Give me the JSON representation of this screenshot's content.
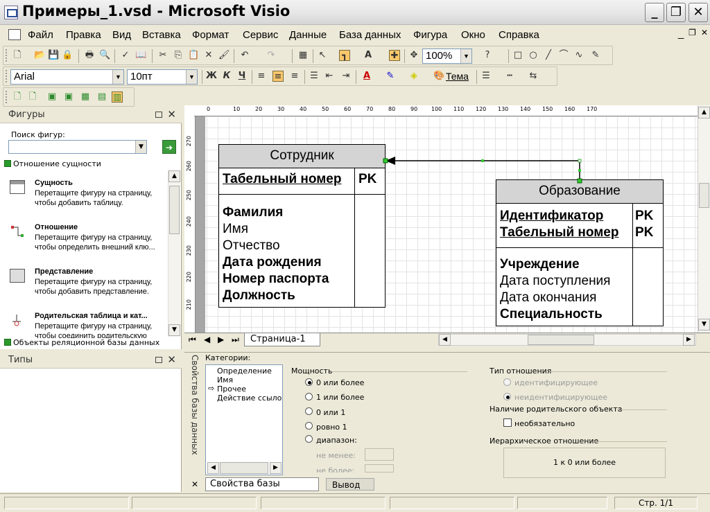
{
  "window": {
    "title": "Примеры_1.vsd - Microsoft Visio",
    "min": "_",
    "max": "❐",
    "close": "✕"
  },
  "menu": [
    "Файл",
    "Правка",
    "Вид",
    "Вставка",
    "Формат",
    "Сервис",
    "Данные",
    "База данных",
    "Фигура",
    "Окно",
    "Справка"
  ],
  "toolbar": {
    "zoom": "100%",
    "font": "Arial",
    "size": "10пт",
    "bold": "Ж",
    "italic": "К",
    "underline": "Ч",
    "theme": "Тема"
  },
  "shapes_panel": {
    "title": "Фигуры",
    "search_label": "Поиск фигур:",
    "stencil1": "Отношение сущности",
    "stencil2": "Объекты реляционной базы данных",
    "items": [
      {
        "name": "Сущность",
        "desc": "Перетащите фигуру на страницу, чтобы добавить таблицу."
      },
      {
        "name": "Отношение",
        "desc": "Перетащите фигуру на страницу, чтобы определить внешний клю..."
      },
      {
        "name": "Представление",
        "desc": "Перетащите фигуру на страницу, чтобы добавить представление."
      },
      {
        "name": "Родительская таблица и кат...",
        "desc": "Перетащите фигуру на страницу, чтобы соединить родительскую"
      }
    ]
  },
  "types_panel": {
    "title": "Типы"
  },
  "ruler": {
    "h": [
      "0",
      "10",
      "20",
      "30",
      "40",
      "50",
      "60",
      "70",
      "80",
      "90",
      "100",
      "110",
      "120",
      "130",
      "140",
      "150",
      "160",
      "170"
    ],
    "v": [
      "270",
      "260",
      "250",
      "240",
      "230",
      "220",
      "210"
    ]
  },
  "entity1": {
    "title": "Сотрудник",
    "pk_field": "Табельный номер",
    "pk": "PK",
    "fields": [
      "Фамилия",
      "Имя",
      "Отчество",
      "Дата рождения",
      "Номер паспорта",
      "Должность"
    ]
  },
  "entity2": {
    "title": "Образование",
    "pk_fields": [
      "Идентификатор",
      "Табельный номер"
    ],
    "pk1": "PK",
    "pk2": "PK",
    "fields": [
      "Учреждение",
      "Дата поступления",
      "Дата окончания",
      "Специальность"
    ]
  },
  "page_tab": "Страница-1",
  "dbprops": {
    "vtitle": "Свойства базы данных",
    "categories_label": "Категории:",
    "categories": [
      "Определение",
      "Имя",
      "Прочее",
      "Действие ссылоч"
    ],
    "cardinality_label": "Мощность",
    "card_opts": [
      "0 или более",
      "1 или более",
      "0 или 1",
      "ровно 1",
      "диапазон:"
    ],
    "min_label": "не менее:",
    "max_label": "не более:",
    "reltype_label": "Тип отношения",
    "rel_opts": [
      "идентифицирующее",
      "неидентифицирующее"
    ],
    "parent_label": "Наличие родительского объекта",
    "optional_label": "необязательно",
    "hier_label": "Иерархическое отношение",
    "hier_value": "1  к  0 или более",
    "tab1": "Свойства базы данных",
    "tab2": "Вывод"
  },
  "status": {
    "page": "Стр. 1/1"
  }
}
